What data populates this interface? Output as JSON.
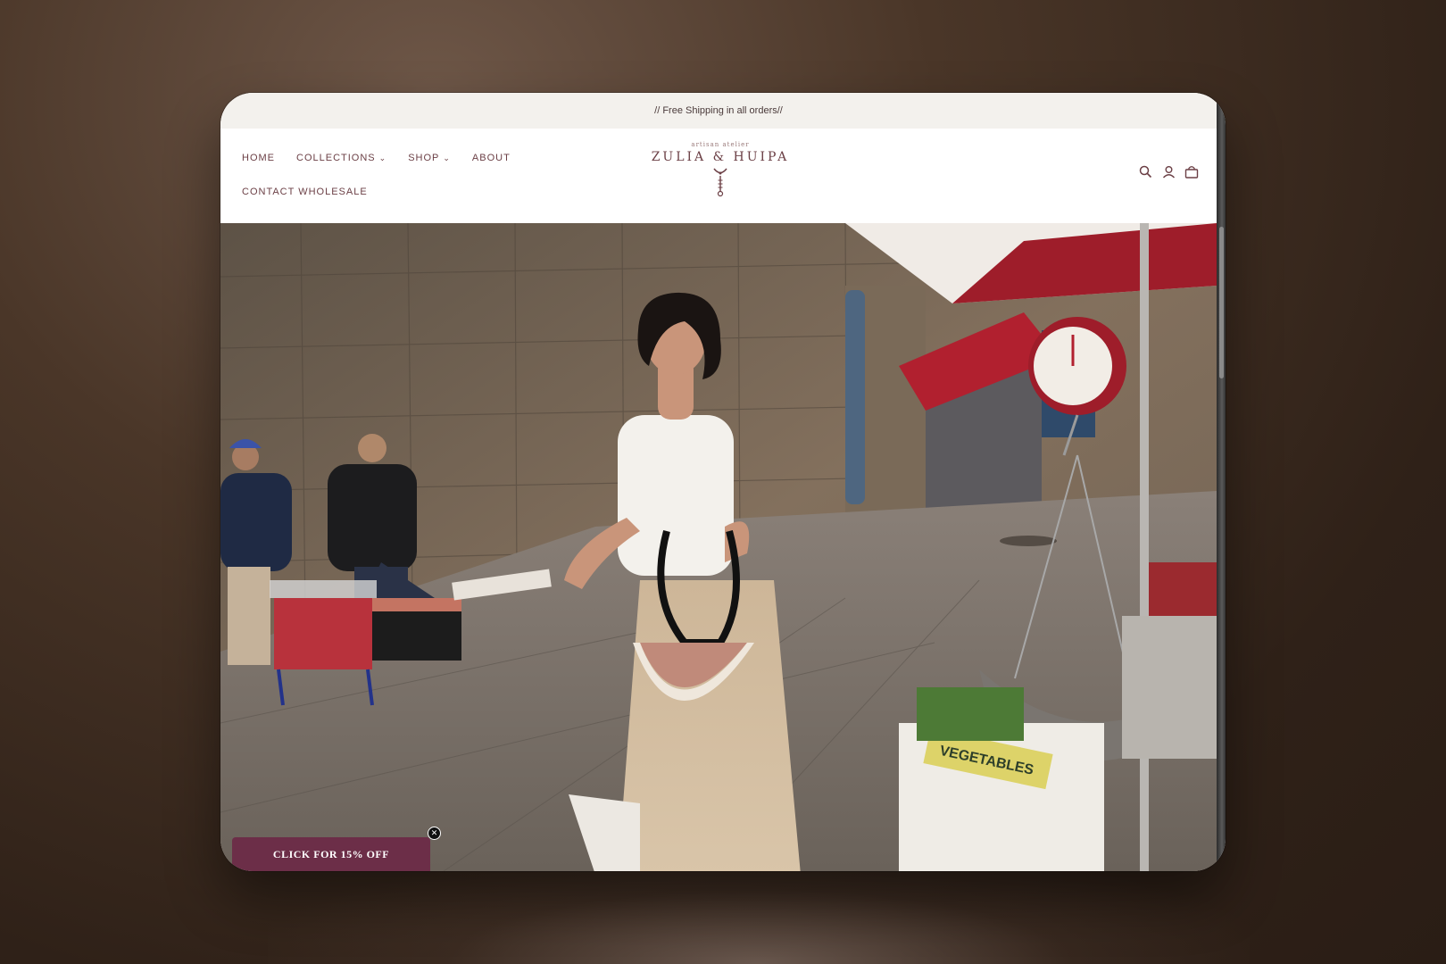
{
  "announcement": "// Free Shipping in all orders//",
  "nav": {
    "row1": [
      {
        "label": "HOME",
        "dropdown": false
      },
      {
        "label": "COLLECTIONS",
        "dropdown": true
      },
      {
        "label": "SHOP",
        "dropdown": true
      },
      {
        "label": "ABOUT",
        "dropdown": false
      }
    ],
    "row2": [
      {
        "label": "CONTACT WHOLESALE",
        "dropdown": false
      }
    ]
  },
  "logo": {
    "tagline": "artisan atelier",
    "name": "ZULIA & HUIPA"
  },
  "header_icons": [
    "search-icon",
    "account-icon",
    "cart-icon"
  ],
  "promo": {
    "label": "CLICK FOR 15% OFF",
    "close": "✕"
  },
  "hero_scale_text": "VEGETABLES",
  "colors": {
    "brand": "#6b3f45",
    "promo": "#6c2e48",
    "announce_bg": "#f3f1ed"
  }
}
